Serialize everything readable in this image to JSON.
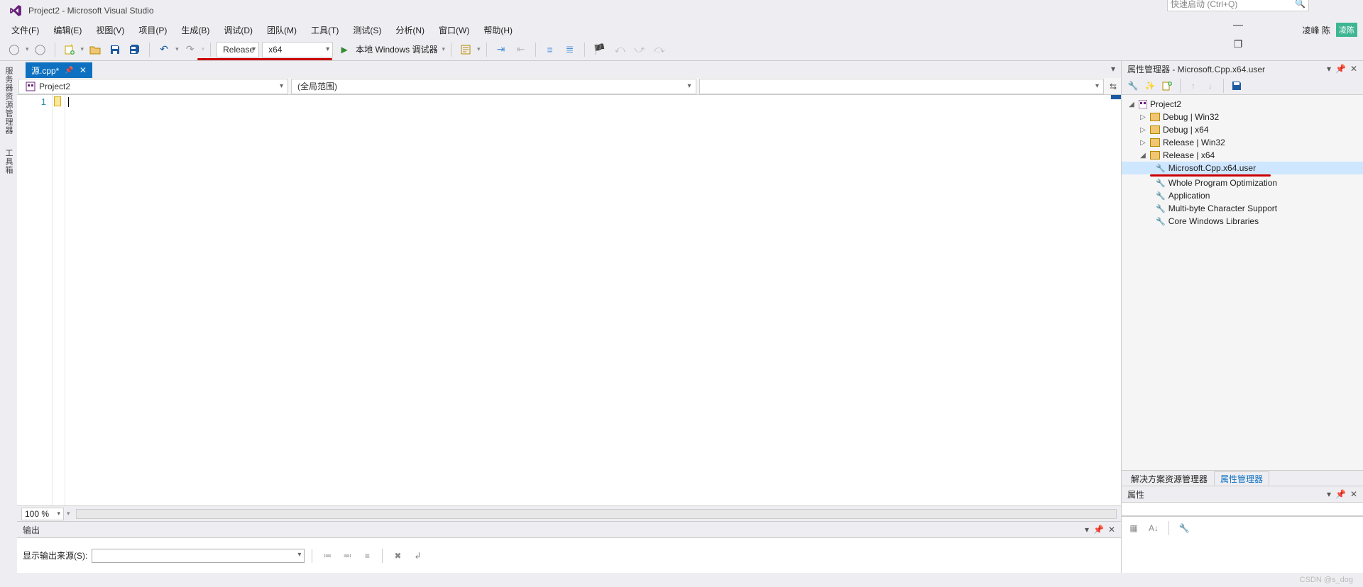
{
  "title": "Project2 - Microsoft Visual Studio",
  "quick_launch_placeholder": "快速启动 (Ctrl+Q)",
  "menu": {
    "file": "文件(F)",
    "edit": "编辑(E)",
    "view": "视图(V)",
    "project": "项目(P)",
    "build": "生成(B)",
    "debug": "调试(D)",
    "team": "团队(M)",
    "tools": "工具(T)",
    "test": "测试(S)",
    "analyze": "分析(N)",
    "window": "窗口(W)",
    "help": "帮助(H)"
  },
  "user": {
    "name": "凌峰 陈",
    "badge": "凌陈"
  },
  "toolbar": {
    "config": "Release",
    "platform": "x64",
    "debugger": "本地 Windows 调试器"
  },
  "doc_tab": {
    "label": "源.cpp*",
    "pin": "⊕"
  },
  "scope": {
    "project": "Project2",
    "scope_label": "(全局范围)",
    "member": ""
  },
  "editor": {
    "line_number": "1"
  },
  "zoom": "100 %",
  "output": {
    "title": "输出",
    "source_label": "显示输出来源(S):"
  },
  "property_manager": {
    "title": "属性管理器 - Microsoft.Cpp.x64.user",
    "root": "Project2",
    "nodes": [
      "Debug | Win32",
      "Debug | x64",
      "Release | Win32",
      "Release | x64"
    ],
    "children": [
      "Microsoft.Cpp.x64.user",
      "Whole Program Optimization",
      "Application",
      "Multi-byte Character Support",
      "Core Windows Libraries"
    ]
  },
  "right_tabs": {
    "solution_explorer": "解决方案资源管理器",
    "property_manager": "属性管理器"
  },
  "props_panel": {
    "title": "属性"
  },
  "watermark": "CSDN @s_dog"
}
